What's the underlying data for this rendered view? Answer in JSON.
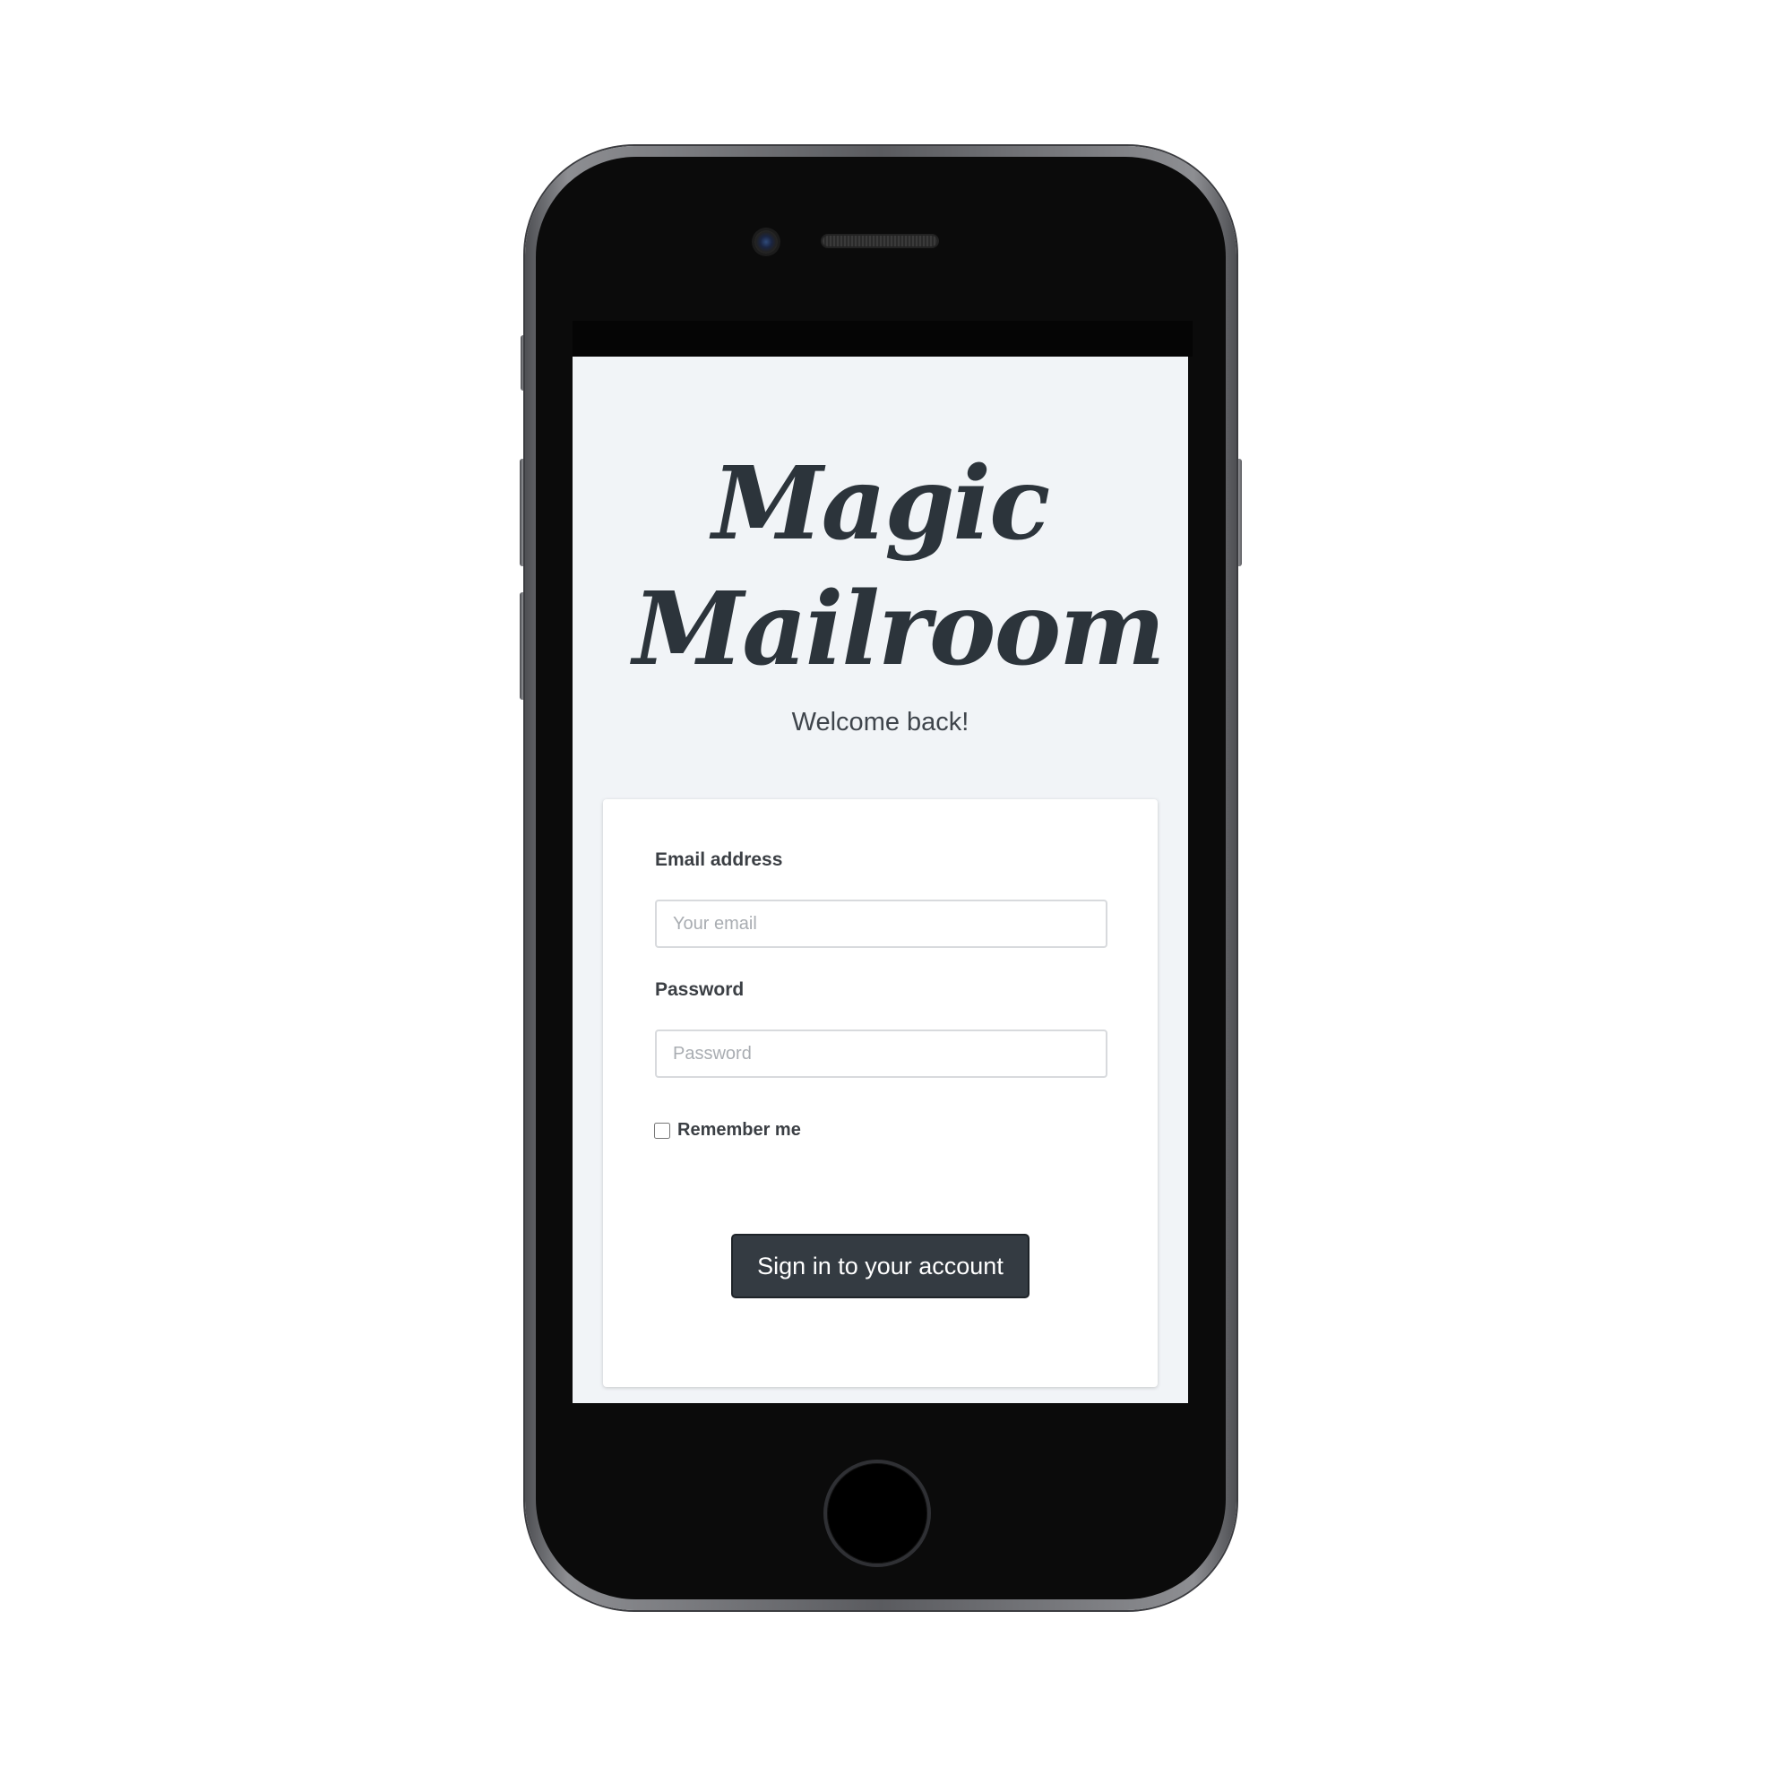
{
  "app": {
    "logo_line1": "Magic",
    "logo_line2": "Mailroom",
    "welcome": "Welcome back!"
  },
  "form": {
    "email_label": "Email address",
    "email_placeholder": "Your email",
    "email_value": "",
    "password_label": "Password",
    "password_placeholder": "Password",
    "password_value": "",
    "remember_label": "Remember me",
    "remember_checked": false,
    "submit_label": "Sign in to your account"
  },
  "colors": {
    "screen_background": "#f1f4f7",
    "text_dark": "#2c343b",
    "button_background": "#343b42",
    "card_background": "#ffffff"
  },
  "icons": {
    "camera": "front-camera-icon",
    "speaker": "earpiece-speaker-icon",
    "home": "home-button-icon"
  }
}
